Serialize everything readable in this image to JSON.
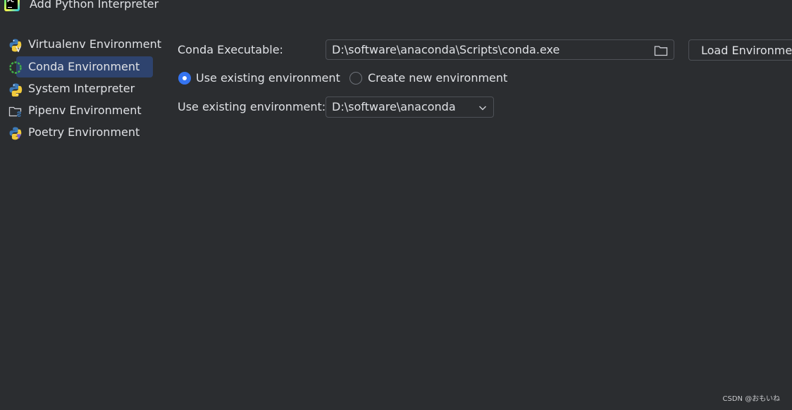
{
  "window": {
    "title": "Add Python Interpreter",
    "app_icon_text": "PC"
  },
  "sidebar": {
    "items": [
      {
        "label": "Virtualenv Environment",
        "icon": "python-virtualenv-icon",
        "selected": false
      },
      {
        "label": "Conda Environment",
        "icon": "conda-icon",
        "selected": true
      },
      {
        "label": "System Interpreter",
        "icon": "python-icon",
        "selected": false
      },
      {
        "label": "Pipenv Environment",
        "icon": "pipenv-folder-icon",
        "selected": false
      },
      {
        "label": "Poetry Environment",
        "icon": "poetry-icon",
        "selected": false
      }
    ]
  },
  "main": {
    "conda_executable": {
      "label": "Conda Executable:",
      "value": "D:\\software\\anaconda\\Scripts\\conda.exe",
      "browse_icon": "folder-icon"
    },
    "load_button": {
      "label": "Load Environments"
    },
    "mode": {
      "use_existing_label": "Use existing environment",
      "create_new_label": "Create new environment",
      "selected": "use_existing"
    },
    "existing_env": {
      "label": "Use existing environment:",
      "value": "D:\\software\\anaconda"
    }
  },
  "watermark": "CSDN @おもいね",
  "colors": {
    "background": "#2b2d30",
    "selection": "#2e436e",
    "accent": "#3574f0",
    "text": "#dfe1e5",
    "border": "#4e5157"
  }
}
